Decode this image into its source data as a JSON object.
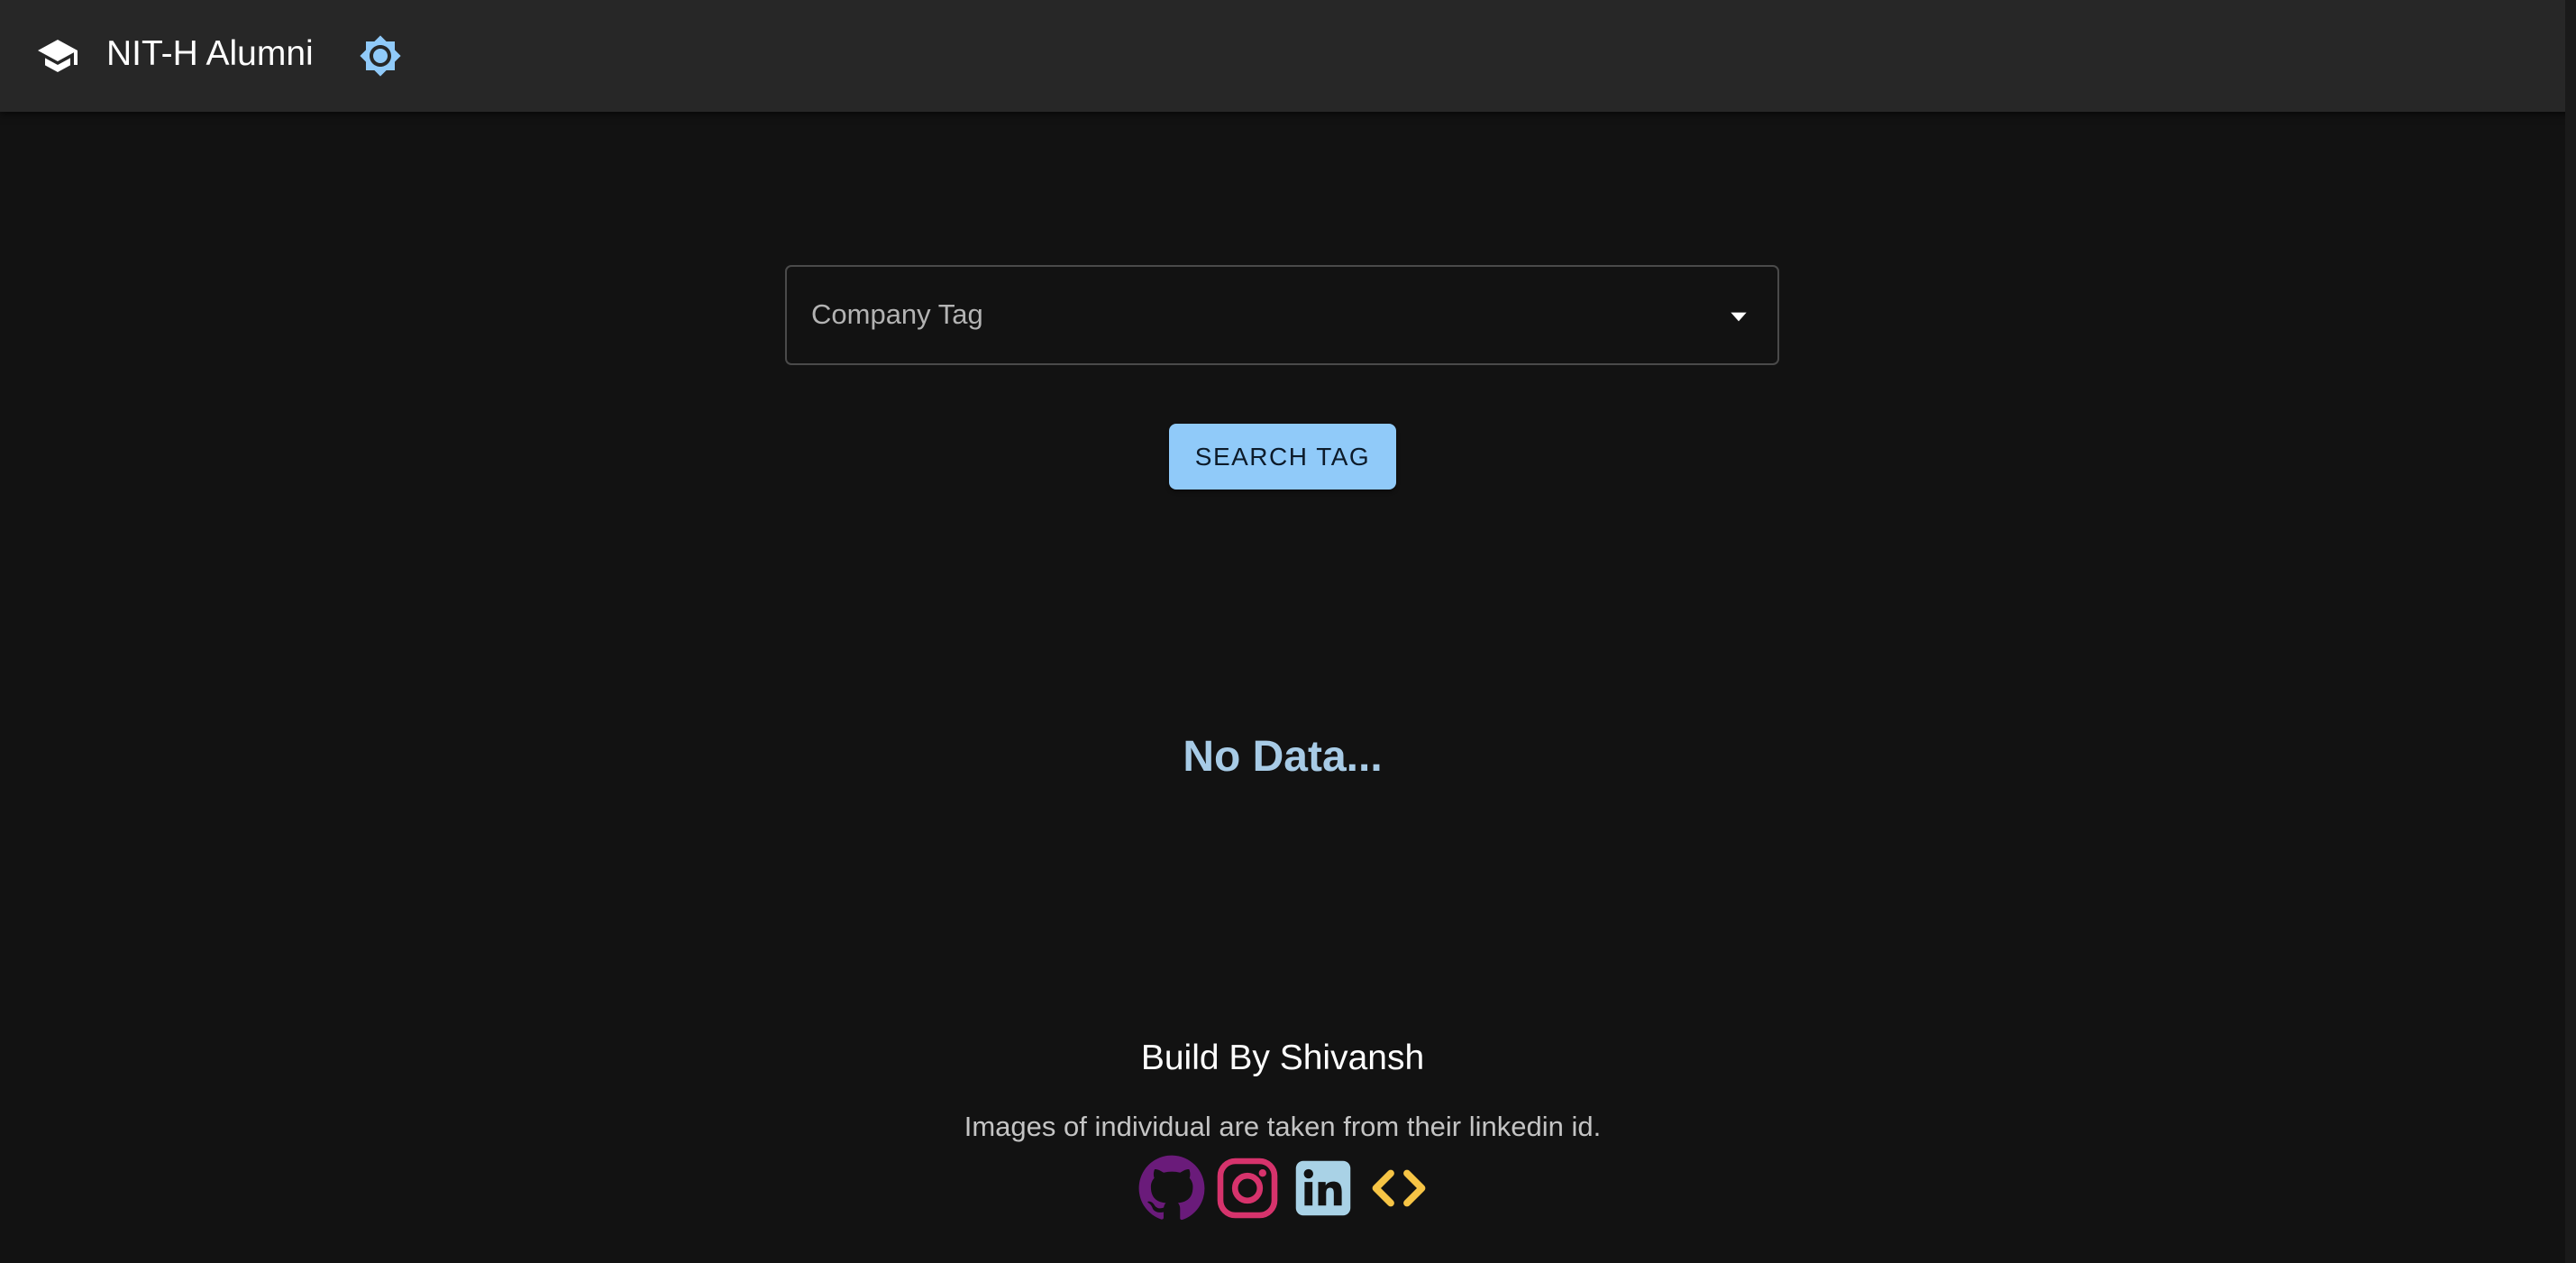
{
  "header": {
    "title": "NIT-H Alumni",
    "brand_icon": "graduation-cap-icon",
    "theme_toggle_icon": "brightness-icon"
  },
  "search": {
    "select_label": "Company Tag",
    "button_label": "SEARCH TAG"
  },
  "results": {
    "empty_message": "No Data..."
  },
  "footer": {
    "title": "Build By Shivansh",
    "note": "Images of individual are taken from their linkedin id.",
    "social": [
      {
        "name": "github-icon",
        "color": "#6a1b7a"
      },
      {
        "name": "instagram-icon",
        "color": "#d6336c"
      },
      {
        "name": "linkedin-icon",
        "color": "#a9d2e6"
      },
      {
        "name": "code-icon",
        "color": "#f6c445"
      }
    ]
  },
  "colors": {
    "background": "#121212",
    "appbar": "#272727",
    "primary": "#90caf9",
    "empty_text": "#a7cbe6"
  }
}
